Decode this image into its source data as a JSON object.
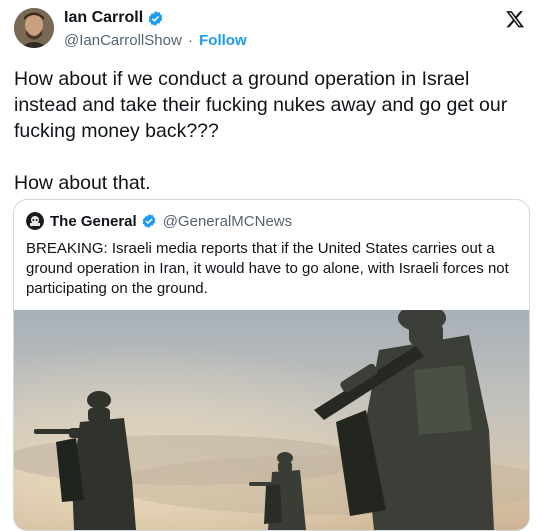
{
  "author": {
    "name": "Ian Carroll",
    "handle": "@IanCarrollShow",
    "separator": "·",
    "follow_label": "Follow"
  },
  "tweet": {
    "text": "How about if we conduct a ground operation in Israel instead and take their fucking nukes away and go get our fucking money back???\n\nHow about that."
  },
  "quoted": {
    "name": "The General",
    "handle": "@GeneralMCNews",
    "text": "BREAKING: Israeli media reports that if the United States carries out a ground operation in Iran, it would have to go alone, with Israeli forces not participating on the ground."
  },
  "colors": {
    "accent": "#1d9bf0",
    "muted": "#536471",
    "text": "#0f1419",
    "border": "#cfd9de"
  },
  "icons": {
    "verified": "verified-badge-icon",
    "platform": "x-logo-icon"
  }
}
